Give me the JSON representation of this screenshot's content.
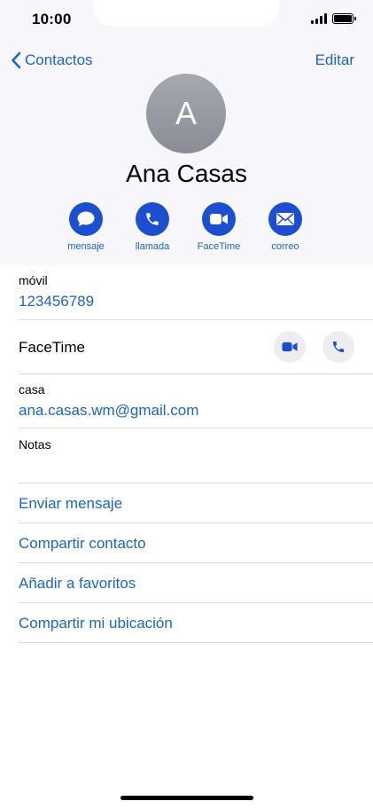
{
  "status_bar": {
    "time": "10:00"
  },
  "nav": {
    "back_label": "Contactos",
    "edit_label": "Editar"
  },
  "contact": {
    "initial": "A",
    "name": "Ana Casas"
  },
  "actions": [
    {
      "label": "mensaje",
      "icon": "message-bubble-icon"
    },
    {
      "label": "llamada",
      "icon": "phone-icon"
    },
    {
      "label": "FaceTime",
      "icon": "video-camera-icon"
    },
    {
      "label": "correo",
      "icon": "envelope-icon"
    }
  ],
  "phone": {
    "label": "móvil",
    "value": "123456789"
  },
  "facetime": {
    "label": "FaceTime"
  },
  "email": {
    "label": "casa",
    "value": "ana.casas.wm@gmail.com"
  },
  "notes": {
    "label": "Notas"
  },
  "links": [
    "Enviar mensaje",
    "Compartir contacto",
    "Añadir a favoritos",
    "Compartir mi ubicación"
  ],
  "colors": {
    "accent": "#1c64c8",
    "action_fill": "#1c4fd0",
    "header_bg": "#f6f6fb",
    "avatar": "#9a9ca4"
  }
}
